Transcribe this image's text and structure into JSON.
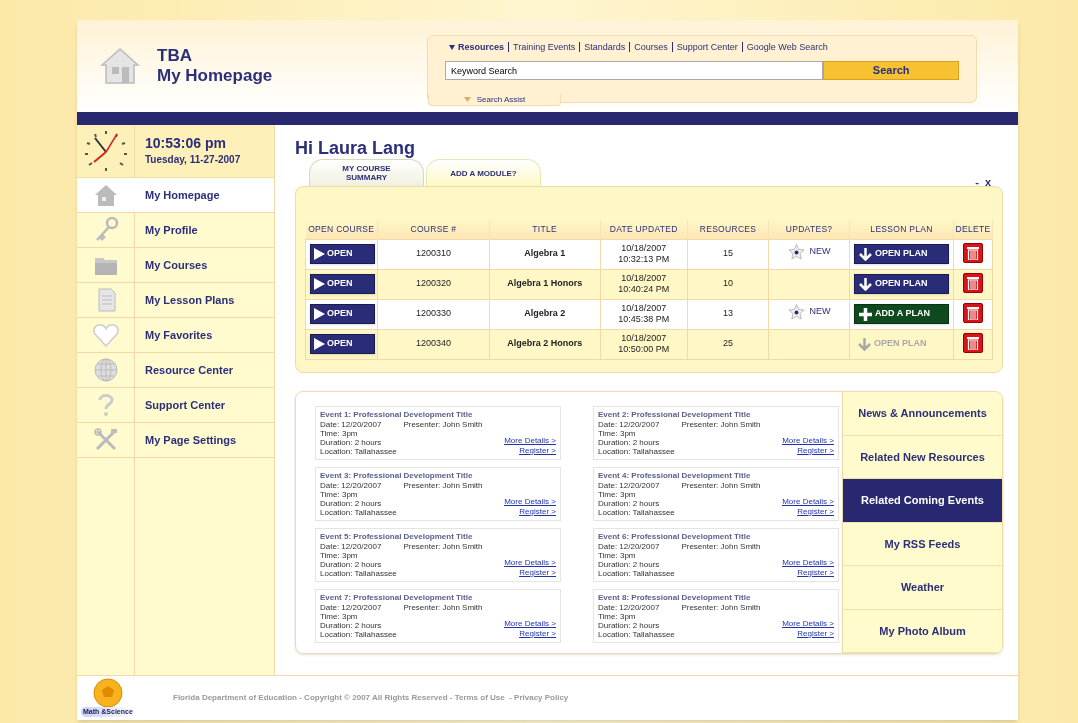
{
  "header": {
    "title": "TBA",
    "subtitle": "My Homepage"
  },
  "search": {
    "links": [
      {
        "label": "Resources",
        "selected": true
      },
      {
        "label": "Training Events",
        "selected": false
      },
      {
        "label": "Standards",
        "selected": false
      },
      {
        "label": "Courses",
        "selected": false
      },
      {
        "label": "Support Center",
        "selected": false
      },
      {
        "label": "Google Web Search",
        "selected": false
      }
    ],
    "placeholder": "Keyword Search",
    "button": "Search",
    "assist": "Search Assist"
  },
  "clock": {
    "time": "10:53:06 pm",
    "date": "Tuesday, 11-27-2007"
  },
  "nav": [
    {
      "label": "My Homepage",
      "selected": true
    },
    {
      "label": "My Profile",
      "selected": false
    },
    {
      "label": "My Courses",
      "selected": false
    },
    {
      "label": "My Lesson Plans",
      "selected": false
    },
    {
      "label": "My Favorites",
      "selected": false
    },
    {
      "label": "Resource Center",
      "selected": false
    },
    {
      "label": "Support Center",
      "selected": false
    },
    {
      "label": "My Page Settings",
      "selected": false
    }
  ],
  "greeting": "Hi Laura Lang",
  "tabs": [
    {
      "label": "MY COURSE SUMMARY",
      "selected": true
    },
    {
      "label": "ADD A MODULE?",
      "selected": false
    }
  ],
  "panel_controls": [
    "-",
    "x"
  ],
  "table": {
    "columns": [
      "OPEN COURSE",
      "COURSE #",
      "TITLE",
      "DATE UPDATED",
      "RESOURCES",
      "UPDATES?",
      "LESSON PLAN",
      "DELETE"
    ],
    "rows": [
      {
        "open": "OPEN",
        "course": "1200310",
        "title": "Algebra 1",
        "date": "10/18/2007",
        "time": "10:32:13 PM",
        "resources": "15",
        "update": "NEW",
        "plan": {
          "kind": "open",
          "label": "OPEN PLAN"
        }
      },
      {
        "open": "OPEN",
        "course": "1200320",
        "title": "Algebra 1 Honors",
        "date": "10/18/2007",
        "time": "10:40:24 PM",
        "resources": "10",
        "plan": {
          "kind": "open",
          "label": "OPEN PLAN"
        }
      },
      {
        "open": "OPEN",
        "course": "1200330",
        "title": "Algebra 2",
        "date": "10/18/2007",
        "time": "10:45:38 PM",
        "resources": "13",
        "update": "NEW",
        "plan": {
          "kind": "add",
          "label": "ADD A PLAN"
        }
      },
      {
        "open": "OPEN",
        "course": "1200340",
        "title": "Algebra 2 Honors",
        "date": "10/18/2007",
        "time": "10:50:00 PM",
        "resources": "25",
        "plan": {
          "kind": "disabled",
          "label": "OPEN PLAN"
        }
      }
    ]
  },
  "events": [
    {
      "title": "Event 1: Professional Development Title",
      "date": "Date: 12/20/2007",
      "presenter": "Presenter: John Smith",
      "time": "Time: 3pm",
      "duration": "Duration: 2 hours",
      "location": "Location: Tallahassee",
      "more": "More Details >",
      "register": "Register >"
    },
    {
      "title": "Event 2: Professional Development Title",
      "date": "Date: 12/20/2007",
      "presenter": "Presenter: John Smith",
      "time": "Time: 3pm",
      "duration": "Duration: 2 hours",
      "location": "Location: Tallahassee",
      "more": "More Details >",
      "register": "Register >"
    },
    {
      "title": "Event 3: Professional Development Title",
      "date": "Date: 12/20/2007",
      "presenter": "Presenter: John Smith",
      "time": "Time: 3pm",
      "duration": "Duration: 2 hours",
      "location": "Location: Tallahassee",
      "more": "More Details >",
      "register": "Register >"
    },
    {
      "title": "Event 4: Professional Development Title",
      "date": "Date: 12/20/2007",
      "presenter": "Presenter: John Smith",
      "time": "Time: 3pm",
      "duration": "Duration: 2 hours",
      "location": "Location: Tallahassee",
      "more": "More Details >",
      "register": "Register >"
    },
    {
      "title": "Event 5: Professional Development Title",
      "date": "Date: 12/20/2007",
      "presenter": "Presenter: John Smith",
      "time": "Time: 3pm",
      "duration": "Duration: 2 hours",
      "location": "Location: Tallahassee",
      "more": "More Details >",
      "register": "Register >"
    },
    {
      "title": "Event 6: Professional Development Title",
      "date": "Date: 12/20/2007",
      "presenter": "Presenter: John Smith",
      "time": "Time: 3pm",
      "duration": "Duration: 2 hours",
      "location": "Location: Tallahassee",
      "more": "More Details >",
      "register": "Register >"
    },
    {
      "title": "Event 7: Professional Development Title",
      "date": "Date: 12/20/2007",
      "presenter": "Presenter: John Smith",
      "time": "Time: 3pm",
      "duration": "Duration: 2 hours",
      "location": "Location: Tallahassee",
      "more": "More Details >",
      "register": "Register >"
    },
    {
      "title": "Event 8: Professional Development Title",
      "date": "Date: 12/20/2007",
      "presenter": "Presenter: John Smith",
      "time": "Time: 3pm",
      "duration": "Duration: 2 hours",
      "location": "Location: Tallahassee",
      "more": "More Details >",
      "register": "Register >"
    }
  ],
  "side_tabs": [
    {
      "label": "News & Announcements",
      "selected": false
    },
    {
      "label": "Related New Resources",
      "selected": false
    },
    {
      "label": "Related Coming Events",
      "selected": true
    },
    {
      "label": "My RSS Feeds",
      "selected": false
    },
    {
      "label": "Weather",
      "selected": false
    },
    {
      "label": "My Photo Album",
      "selected": false
    }
  ],
  "footer": {
    "logo_text": "Math &Science",
    "text": "Florida Department of Education - Copyright © 2007 All Rights Reserved - Terms of Use  - Privacy Policy"
  }
}
